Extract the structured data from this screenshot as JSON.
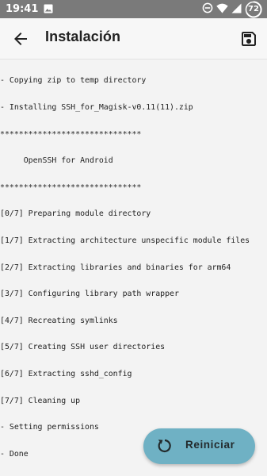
{
  "status_bar": {
    "time": "19:41",
    "battery_level": "72",
    "icons": [
      "image-icon",
      "do-not-disturb-icon",
      "wifi-icon",
      "signal-icon",
      "battery-icon"
    ]
  },
  "app_bar": {
    "title": "Instalación",
    "back_icon": "arrow-back-icon",
    "save_icon": "save-icon"
  },
  "log": {
    "lines": [
      "- Copying zip to temp directory",
      "- Installing SSH_for_Magisk-v0.11(11).zip",
      "******************************",
      "     OpenSSH for Android",
      "******************************",
      "[0/7] Preparing module directory",
      "[1/7] Extracting architecture unspecific module files",
      "[2/7] Extracting libraries and binaries for arm64",
      "[3/7] Configuring library path wrapper",
      "[4/7] Recreating symlinks",
      "[5/7] Creating SSH user directories",
      "[6/7] Extracting sshd_config",
      "[7/7] Cleaning up",
      "- Setting permissions",
      "- Done"
    ]
  },
  "fab": {
    "label": "Reiniciar",
    "icon": "restart-icon"
  },
  "colors": {
    "status_bar": "#7a7a7a",
    "app_bar": "#f7f7f7",
    "background": "#f3f3f3",
    "fab": "#6fb1c4"
  }
}
